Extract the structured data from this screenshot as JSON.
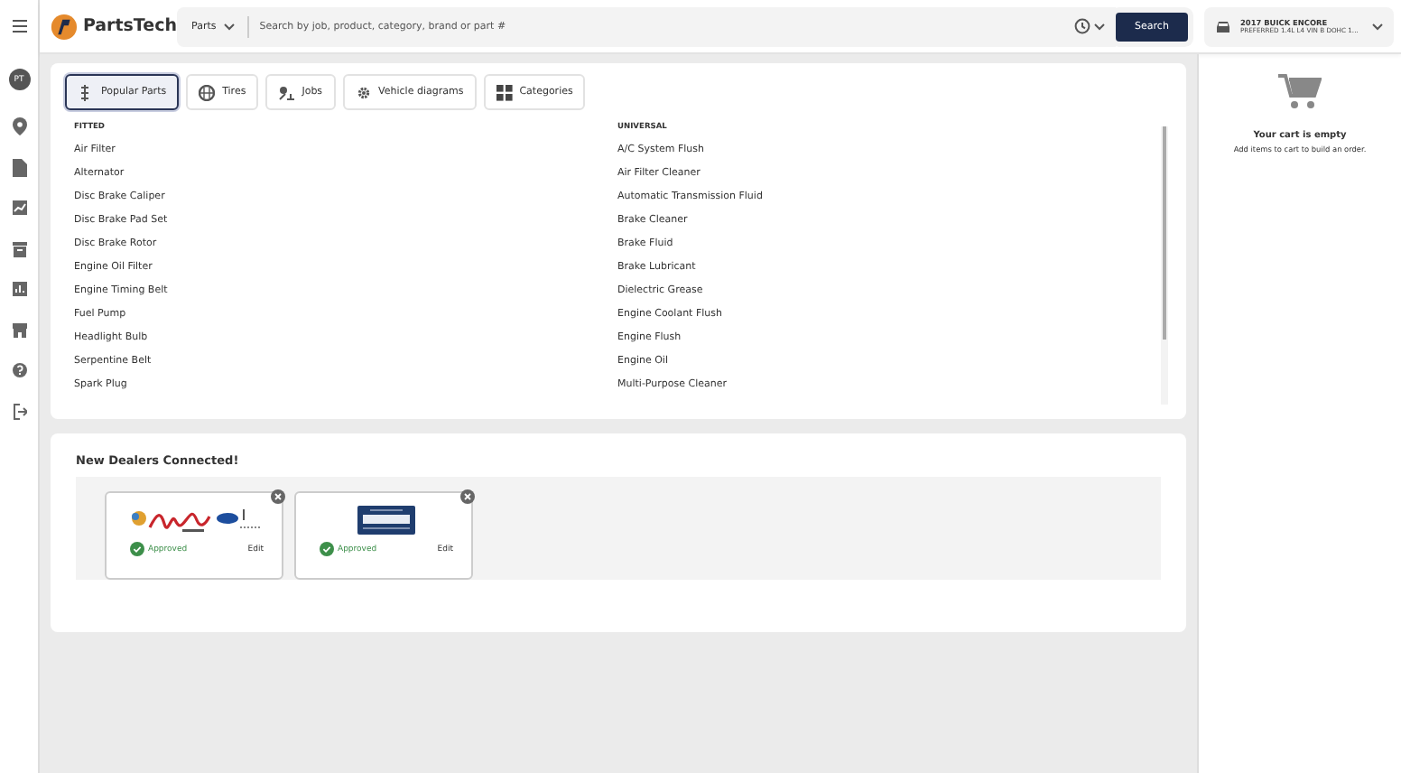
{
  "sidebar": {
    "avatar": "PT"
  },
  "header": {
    "brand": "PartsTech",
    "scope": "Parts",
    "search_placeholder": "Search by job, product, category, brand or part #",
    "search_button": "Search",
    "vehicle": {
      "title": "2017 BUICK ENCORE",
      "subtitle": "PREFERRED 1.4L L4 VIN B DOHC 1..."
    }
  },
  "tabs": [
    {
      "label": "Popular Parts",
      "selected": true
    },
    {
      "label": "Tires",
      "selected": false
    },
    {
      "label": "Jobs",
      "selected": false
    },
    {
      "label": "Vehicle diagrams",
      "selected": false
    },
    {
      "label": "Categories",
      "selected": false
    }
  ],
  "columns": [
    {
      "heading": "FITTED",
      "items": [
        "Air Filter",
        "Alternator",
        "Disc Brake Caliper",
        "Disc Brake Pad Set",
        "Disc Brake Rotor",
        "Engine Oil Filter",
        "Engine Timing Belt",
        "Fuel Pump",
        "Headlight Bulb",
        "Serpentine Belt",
        "Spark Plug"
      ]
    },
    {
      "heading": "UNIVERSAL",
      "items": [
        "A/C System Flush",
        "Air Filter Cleaner",
        "Automatic Transmission Fluid",
        "Brake Cleaner",
        "Brake Fluid",
        "Brake Lubricant",
        "Dielectric Grease",
        "Engine Coolant Flush",
        "Engine Flush",
        "Engine Oil",
        "Multi-Purpose Cleaner"
      ]
    }
  ],
  "dealers": {
    "title": "New Dealers Connected!",
    "cards": [
      {
        "status": "Approved",
        "action": "Edit"
      },
      {
        "status": "Approved",
        "action": "Edit"
      }
    ]
  },
  "cart": {
    "title": "Your cart is empty",
    "message": "Add items to cart to build an order."
  }
}
